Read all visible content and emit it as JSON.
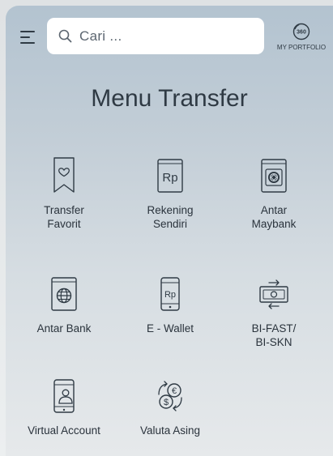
{
  "header": {
    "search_placeholder": "Cari ...",
    "portfolio_badge": "360",
    "portfolio_label": "MY PORTFOLIO"
  },
  "title": "Menu Transfer",
  "menu": [
    {
      "line1": "Transfer",
      "line2": "Favorit",
      "icon": "bookmark-heart-icon"
    },
    {
      "line1": "Rekening",
      "line2": "Sendiri",
      "icon": "rupiah-book-icon"
    },
    {
      "line1": "Antar",
      "line2": "Maybank",
      "icon": "maybank-book-icon"
    },
    {
      "line1": "Antar Bank",
      "line2": "",
      "icon": "globe-book-icon"
    },
    {
      "line1": "E - Wallet",
      "line2": "",
      "icon": "rupiah-phone-icon"
    },
    {
      "line1": "BI-FAST/",
      "line2": "BI-SKN",
      "icon": "banknote-transfer-icon"
    },
    {
      "line1": "Virtual Account",
      "line2": "",
      "icon": "phone-user-icon"
    },
    {
      "line1": "Valuta Asing",
      "line2": "",
      "icon": "currency-exchange-icon"
    }
  ],
  "colors": {
    "icon_stroke": "#2f3a44",
    "text": "#2a333c",
    "background_top": "#b3c3d0",
    "background_bottom": "#e6e9eb"
  }
}
